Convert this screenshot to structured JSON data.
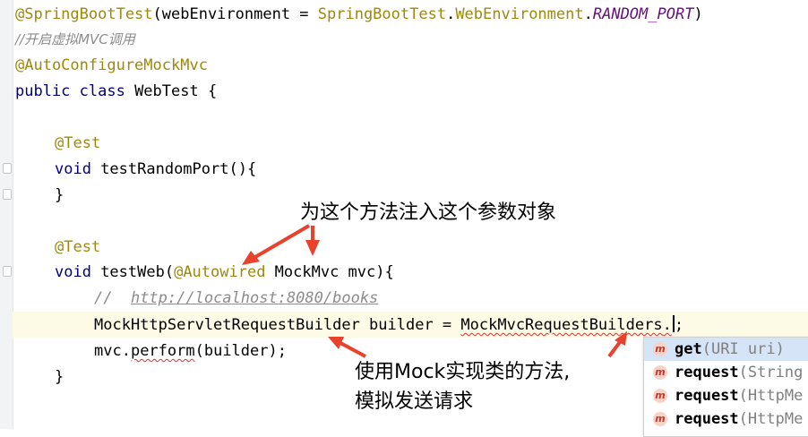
{
  "editor": {
    "lines": {
      "l1_anno": "@SpringBootTest",
      "l1_rest": "(webEnvironment = ",
      "l1_class": "SpringBootTest",
      "l1_dot": ".",
      "l1_enum": "WebEnvironment",
      "l1_dot2": ".",
      "l1_const": "RANDOM_PORT",
      "l1_close": ")",
      "l2_comment": "//开启虚拟MVC调用",
      "l3_anno": "@AutoConfigureMockMvc",
      "l4_kw": "public class",
      "l4_rest": " WebTest {",
      "l6_anno": "@Test",
      "l7_kw": "void",
      "l7_rest": " testRandomPort(){",
      "l8": "}",
      "l10_anno": "@Test",
      "l11_kw": "void",
      "l11_method": " testWeb(",
      "l11_anno": "@Autowired",
      "l11_rest": " MockMvc mvc){",
      "l12_comment": "//  ",
      "l12_link": "http://localhost:8080/books",
      "l13_type": "MockHttpServletRequestBuilder",
      "l13_mid": " builder = ",
      "l13_call": "MockMvcRequestBuilders",
      "l13_dot": ".",
      "l13_end": ";",
      "l14_a": "mvc.",
      "l14_perform": "perform",
      "l14_b": "(builder);",
      "l15": "}"
    }
  },
  "annotations": {
    "top": "为这个方法注入这个参数对象",
    "bottom_line1": "使用Mock实现类的方法,",
    "bottom_line2": "模拟发送请求"
  },
  "autocomplete": {
    "items": [
      {
        "name": "get",
        "args": "(URI uri)"
      },
      {
        "name": "request",
        "args": "(String"
      },
      {
        "name": "request",
        "args": "(HttpMe"
      },
      {
        "name": "request",
        "args": "(HttpMe"
      }
    ],
    "icon_letter": "m"
  },
  "colors": {
    "annotation": "#9e880d",
    "keyword": "#000080",
    "comment": "#8c8c8c",
    "arrow": "#e8412c",
    "highlight_line": "#fdfbe5"
  }
}
